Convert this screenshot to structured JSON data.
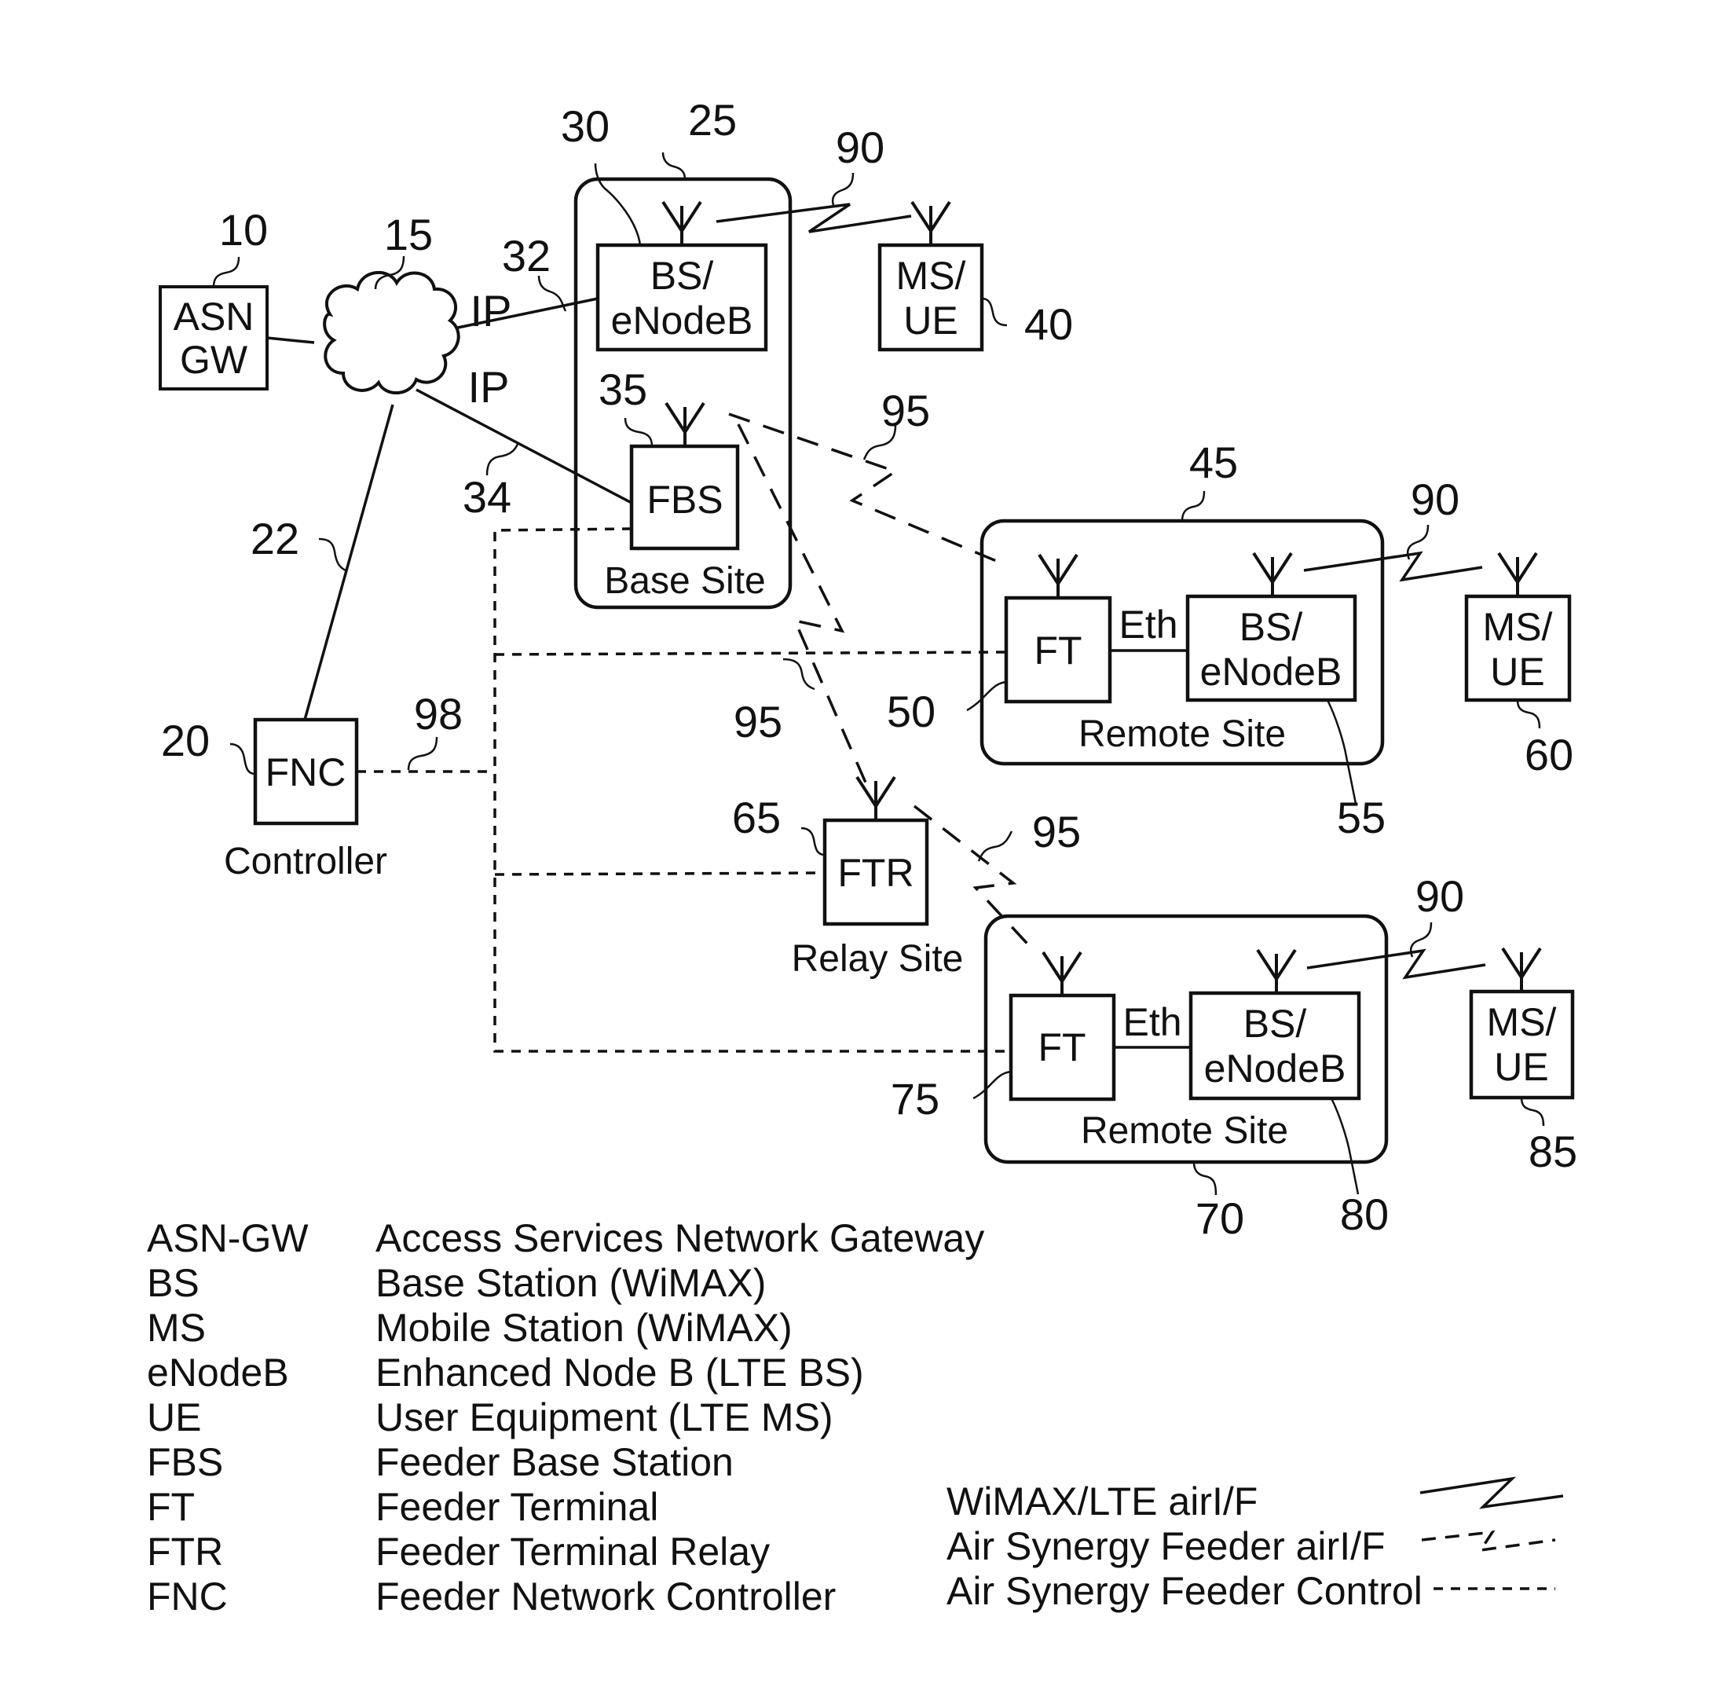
{
  "nodes": {
    "asn_gw": {
      "ref": "10",
      "lines": [
        "ASN",
        "GW"
      ]
    },
    "cloud": {
      "ref": "15"
    },
    "fnc": {
      "ref": "20",
      "label": "FNC",
      "caption": "Controller"
    },
    "base_site": {
      "ref": "25",
      "caption": "Base Site"
    },
    "base_bs": {
      "ref": "30",
      "lines": [
        "BS/",
        "eNodeB"
      ]
    },
    "fbs": {
      "ref": "35",
      "label": "FBS"
    },
    "ms_ue_40": {
      "ref": "40",
      "lines": [
        "MS/",
        "UE"
      ]
    },
    "remote_site_45": {
      "ref": "45",
      "caption": "Remote Site"
    },
    "ft_50": {
      "ref": "50",
      "label": "FT"
    },
    "bs_55": {
      "ref": "55",
      "lines": [
        "BS/",
        "eNodeB"
      ]
    },
    "ms_ue_60": {
      "ref": "60",
      "lines": [
        "MS/",
        "UE"
      ]
    },
    "ftr_65": {
      "ref": "65",
      "label": "FTR",
      "caption": "Relay Site"
    },
    "remote_site_70": {
      "ref": "70",
      "caption": "Remote Site"
    },
    "ft_75": {
      "ref": "75",
      "label": "FT"
    },
    "bs_80": {
      "ref": "80",
      "lines": [
        "BS/",
        "eNodeB"
      ]
    },
    "ms_ue_85": {
      "ref": "85",
      "lines": [
        "MS/",
        "UE"
      ]
    }
  },
  "links": {
    "ip_32": {
      "ref": "32",
      "label": "IP"
    },
    "ip_34": {
      "ref": "34",
      "label": "IP"
    },
    "control_22": {
      "ref": "22"
    },
    "control_98": {
      "ref": "98"
    },
    "eth_label": "Eth",
    "air_90": "90",
    "feeder_95": "95"
  },
  "legend": {
    "abbreviations": [
      {
        "abbr": "ASN-GW",
        "desc": "Access Services Network Gateway"
      },
      {
        "abbr": "BS",
        "desc": "Base Station (WiMAX)"
      },
      {
        "abbr": "MS",
        "desc": "Mobile Station (WiMAX)"
      },
      {
        "abbr": "eNodeB",
        "desc": "Enhanced Node B (LTE BS)"
      },
      {
        "abbr": "UE",
        "desc": "User Equipment (LTE MS)"
      },
      {
        "abbr": "FBS",
        "desc": "Feeder Base Station"
      },
      {
        "abbr": "FT",
        "desc": "Feeder Terminal"
      },
      {
        "abbr": "FTR",
        "desc": "Feeder Terminal Relay"
      },
      {
        "abbr": "FNC",
        "desc": "Feeder Network Controller"
      }
    ],
    "line_types": [
      {
        "name": "WiMAX/LTE airI/F",
        "style": "solid-zigzag"
      },
      {
        "name": "Air Synergy Feeder airI/F",
        "style": "dashed-zigzag"
      },
      {
        "name": "Air Synergy Feeder Control",
        "style": "dotted"
      }
    ]
  }
}
